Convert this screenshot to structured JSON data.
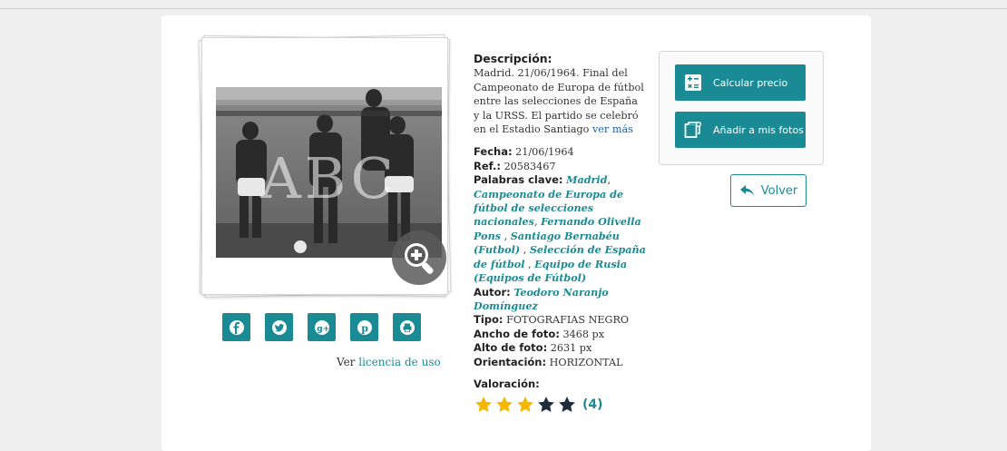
{
  "photo": {
    "watermark": "ABC",
    "zoom_icon": "zoom-in-icon"
  },
  "share": {
    "icons": [
      "facebook-icon",
      "twitter-icon",
      "google-plus-icon",
      "pinterest-icon",
      "print-icon"
    ]
  },
  "license": {
    "prefix": "Ver",
    "link": "licencia de uso"
  },
  "details": {
    "desc_title": "Descripción:",
    "desc_text": "Madrid. 21/06/1964. Final del Campeonato de Europa de fútbol entre las selecciones de España y la URSS. El partido se celebró en el Estadio Santiago",
    "ver_mas": "ver más",
    "fecha_label": "Fecha:",
    "fecha_value": "21/06/1964",
    "ref_label": "Ref.:",
    "ref_value": "20583467",
    "palabras_label": "Palabras clave:",
    "keywords": [
      "Madrid",
      "Campeonato de Europa de fútbol de selecciones nacionales",
      "Fernando Olivella Pons",
      "Santiago Bernabéu (Futbol)",
      "Selección de España de fútbol",
      "Equipo de Rusia (Equipos de Fútbol)"
    ],
    "autor_label": "Autor:",
    "autor_value": "Teodoro Naranjo Domínguez",
    "tipo_label": "Tipo:",
    "tipo_value": "FOTOGRAFIAS NEGRO",
    "ancho_label": "Ancho de foto:",
    "ancho_value": "3468 px",
    "alto_label": "Alto de foto:",
    "alto_value": "2631 px",
    "orient_label": "Orientación:",
    "orient_value": "HORIZONTAL",
    "valoracion_label": "Valoración:"
  },
  "rating": {
    "filled": 3,
    "total": 5,
    "count": "(4)",
    "filled_color": "#f5b800",
    "empty_color": "#1f2d3a"
  },
  "actions": {
    "calc_label": "Calcular precio",
    "add_label": "Añadir a mis fotos",
    "volver_label": "Volver"
  },
  "colors": {
    "accent": "#1a8b94"
  }
}
